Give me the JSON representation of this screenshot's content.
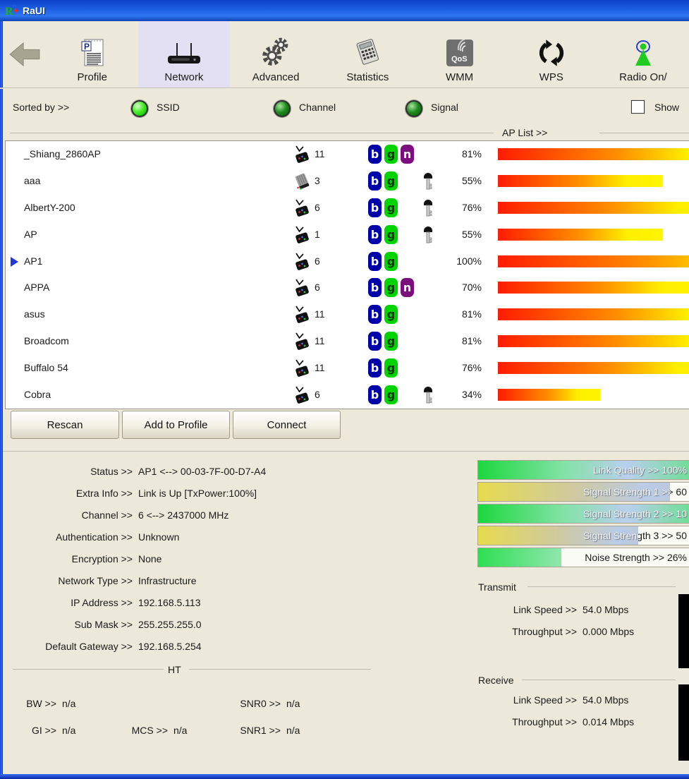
{
  "window": {
    "title": "RaUI"
  },
  "toolbar": {
    "tabs": [
      {
        "label": "Profile",
        "icon": "profile-icon",
        "selected": false
      },
      {
        "label": "Network",
        "icon": "network-icon",
        "selected": true
      },
      {
        "label": "Advanced",
        "icon": "advanced-icon",
        "selected": false
      },
      {
        "label": "Statistics",
        "icon": "statistics-icon",
        "selected": false
      },
      {
        "label": "WMM",
        "icon": "wmm-icon",
        "selected": false
      },
      {
        "label": "WPS",
        "icon": "wps-icon",
        "selected": false
      },
      {
        "label": "Radio On/",
        "icon": "radio-icon",
        "selected": false
      }
    ]
  },
  "sort_bar": {
    "label": "Sorted by >>",
    "options": [
      {
        "label": "SSID",
        "selected": true
      },
      {
        "label": "Channel",
        "selected": false
      },
      {
        "label": "Signal",
        "selected": false
      }
    ],
    "checkbox": {
      "label": "Show",
      "checked": false
    }
  },
  "ap_list": {
    "section_label": "AP List >>",
    "rows": [
      {
        "ssid": "_Shiang_2860AP",
        "channel": "11",
        "icon": "ap",
        "modes": [
          "b",
          "g",
          "n"
        ],
        "encrypted": false,
        "signal": "81%",
        "signal_pct": 81,
        "selected": false
      },
      {
        "ssid": "aaa",
        "channel": "3",
        "icon": "adhoc",
        "modes": [
          "b",
          "g"
        ],
        "encrypted": true,
        "signal": "55%",
        "signal_pct": 55,
        "selected": false
      },
      {
        "ssid": "AlbertY-200",
        "channel": "6",
        "icon": "ap",
        "modes": [
          "b",
          "g"
        ],
        "encrypted": true,
        "signal": "76%",
        "signal_pct": 76,
        "selected": false
      },
      {
        "ssid": "AP",
        "channel": "1",
        "icon": "ap",
        "modes": [
          "b",
          "g"
        ],
        "encrypted": true,
        "signal": "55%",
        "signal_pct": 55,
        "selected": false
      },
      {
        "ssid": "AP1",
        "channel": "6",
        "icon": "ap",
        "modes": [
          "b",
          "g"
        ],
        "encrypted": false,
        "signal": "100%",
        "signal_pct": 100,
        "selected": true
      },
      {
        "ssid": "APPA",
        "channel": "6",
        "icon": "ap",
        "modes": [
          "b",
          "g",
          "n"
        ],
        "encrypted": false,
        "signal": "70%",
        "signal_pct": 70,
        "selected": false
      },
      {
        "ssid": "asus",
        "channel": "11",
        "icon": "ap",
        "modes": [
          "b",
          "g"
        ],
        "encrypted": false,
        "signal": "81%",
        "signal_pct": 81,
        "selected": false
      },
      {
        "ssid": "Broadcom",
        "channel": "11",
        "icon": "ap",
        "modes": [
          "b",
          "g"
        ],
        "encrypted": false,
        "signal": "81%",
        "signal_pct": 81,
        "selected": false
      },
      {
        "ssid": "Buffalo 54",
        "channel": "11",
        "icon": "ap",
        "modes": [
          "b",
          "g"
        ],
        "encrypted": false,
        "signal": "76%",
        "signal_pct": 76,
        "selected": false
      },
      {
        "ssid": "Cobra",
        "channel": "6",
        "icon": "ap",
        "modes": [
          "b",
          "g"
        ],
        "encrypted": true,
        "signal": "34%",
        "signal_pct": 34,
        "selected": false
      }
    ]
  },
  "buttons": {
    "rescan": "Rescan",
    "add_to_profile": "Add to Profile",
    "connect": "Connect"
  },
  "status_panel": {
    "rows": [
      {
        "label": "Status >>",
        "value": "AP1 <--> 00-03-7F-00-D7-A4"
      },
      {
        "label": "Extra Info >>",
        "value": "Link is Up [TxPower:100%]"
      },
      {
        "label": "Channel >>",
        "value": "6 <--> 2437000 MHz"
      },
      {
        "label": "Authentication >>",
        "value": "Unknown"
      },
      {
        "label": "Encryption >>",
        "value": "None"
      },
      {
        "label": "Network Type >>",
        "value": "Infrastructure"
      },
      {
        "label": "IP Address >>",
        "value": "192.168.5.113"
      },
      {
        "label": "Sub Mask >>",
        "value": "255.255.255.0"
      },
      {
        "label": "Default Gateway >>",
        "value": "192.168.5.254"
      }
    ],
    "ht_section": {
      "label": "HT",
      "fields": [
        {
          "label": "BW >>",
          "value": "n/a"
        },
        {
          "label": "GI >>",
          "value": "n/a"
        },
        {
          "label": "MCS >>",
          "value": "n/a"
        },
        {
          "label": "SNR0 >>",
          "value": "n/a"
        },
        {
          "label": "SNR1 >>",
          "value": "n/a"
        }
      ]
    }
  },
  "link_panel": {
    "bars": [
      {
        "label": "Link Quality >> 100%",
        "fill_pct": 100,
        "palette": "green"
      },
      {
        "label": "Signal Strength 1 >> 60",
        "fill_pct": 90,
        "palette": "yellow"
      },
      {
        "label": "Signal Strength 2 >> 10",
        "fill_pct": 100,
        "palette": "green"
      },
      {
        "label": "Signal Strength 3 >> 50",
        "fill_pct": 75,
        "palette": "yellow"
      },
      {
        "label": "Noise Strength >> 26%",
        "fill_pct": 39,
        "palette": "green2"
      }
    ],
    "transmit": {
      "label": "Transmit",
      "fields": [
        {
          "label": "Link Speed >>",
          "value": "54.0 Mbps"
        },
        {
          "label": "Throughput >>",
          "value": "0.000 Mbps"
        }
      ]
    },
    "receive": {
      "label": "Receive",
      "fields": [
        {
          "label": "Link Speed >>",
          "value": "54.0 Mbps"
        },
        {
          "label": "Throughput >>",
          "value": "0.014 Mbps"
        }
      ]
    }
  },
  "colors": {
    "titlebar_blue": "#1b5cdf",
    "window_bg": "#ece9db",
    "selected_tab_bg": "#e2e0f2",
    "band_b_badge": "#0000a8",
    "band_g_badge": "#00d400",
    "band_n_badge": "#7c0f7e",
    "signal_bar_start": "#ff1c00",
    "signal_bar_end": "#fff500",
    "quality_bar_green": "#1cd73e",
    "strength_bar_yellow": "#e6db4d"
  }
}
